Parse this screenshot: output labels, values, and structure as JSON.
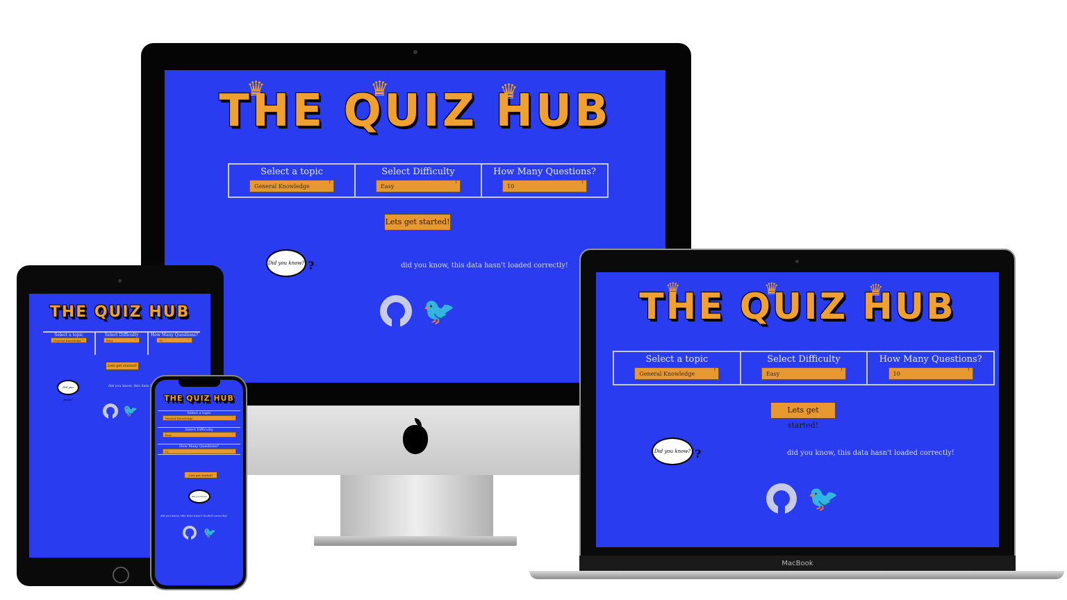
{
  "app": {
    "logo_text": "THE QUIZ HUB",
    "crown_glyph": "♛",
    "colors": {
      "background": "#2a3cf0",
      "accent": "#e89830",
      "logo": "#f0a030",
      "border": "#c8cbe8"
    }
  },
  "options": [
    {
      "label": "Select a topic",
      "value": "General Knowledge"
    },
    {
      "label": "Select Difficulty",
      "value": "Easy"
    },
    {
      "label": "How Many Questions?",
      "value": "10"
    }
  ],
  "start_button": "Lets get started!",
  "bubble_text": "Did you know?",
  "question_mark": "?",
  "fact_text": "did you know, this data hasn't loaded correctly!",
  "social": {
    "github_icon": "github-icon",
    "twitter_icon": "twitter-icon",
    "twitter_glyph": "🐦"
  },
  "laptop_brand": "MacBook",
  "apple_glyph": ""
}
